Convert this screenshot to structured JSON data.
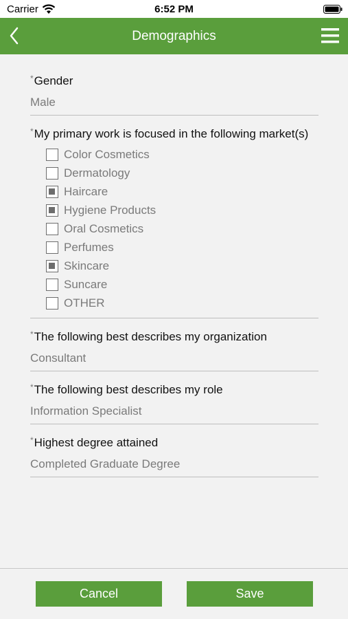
{
  "status_bar": {
    "carrier": "Carrier",
    "time": "6:52 PM",
    "wifi_icon": "wifi-icon",
    "battery_icon": "battery-icon"
  },
  "nav": {
    "title": "Demographics",
    "back_icon": "chevron-left-icon",
    "menu_icon": "hamburger-menu-icon",
    "color": "#5a9e3c"
  },
  "form": {
    "required_marker": "*",
    "gender": {
      "label": "Gender",
      "value": "Male"
    },
    "markets": {
      "label": "My primary work is focused in the following market(s)",
      "options": [
        {
          "label": "Color Cosmetics",
          "checked": false
        },
        {
          "label": "Dermatology",
          "checked": false
        },
        {
          "label": "Haircare",
          "checked": true
        },
        {
          "label": "Hygiene Products",
          "checked": true
        },
        {
          "label": "Oral Cosmetics",
          "checked": false
        },
        {
          "label": "Perfumes",
          "checked": false
        },
        {
          "label": "Skincare",
          "checked": true
        },
        {
          "label": "Suncare",
          "checked": false
        },
        {
          "label": "OTHER",
          "checked": false
        }
      ]
    },
    "organization": {
      "label": "The following best describes my organization",
      "value": "Consultant"
    },
    "role": {
      "label": "The following best describes my role",
      "value": "Information Specialist"
    },
    "degree": {
      "label": "Highest degree attained",
      "value": "Completed Graduate Degree"
    }
  },
  "actions": {
    "cancel_label": "Cancel",
    "save_label": "Save"
  }
}
